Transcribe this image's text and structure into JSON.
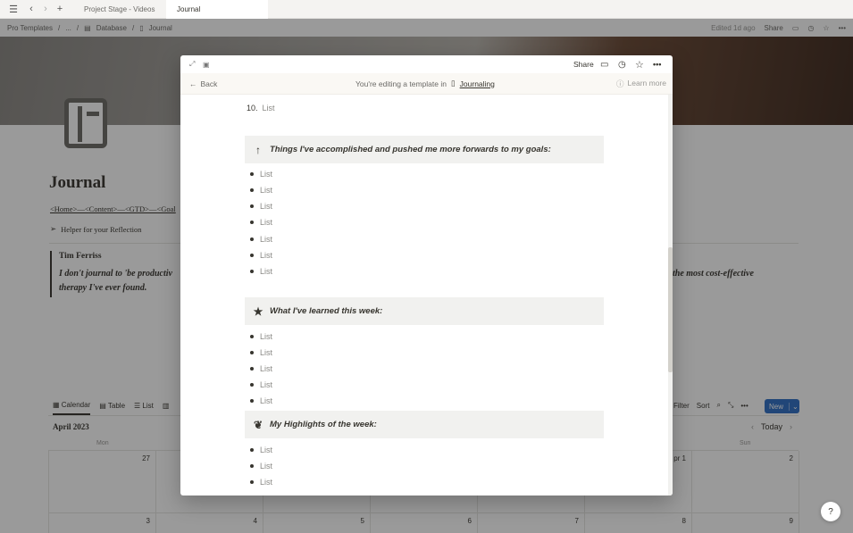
{
  "browser": {
    "tabs": [
      "Project Stage - Videos",
      "Journal"
    ]
  },
  "header": {
    "breadcrumbs": [
      "Pro Templates",
      "/",
      "...",
      "/",
      "Database",
      "/",
      "Journal"
    ],
    "edited": "Edited 1d ago",
    "share": "Share"
  },
  "page": {
    "title": "Journal",
    "nav_links": "<Home>—<Content>—<GTD>—<Goal",
    "helper": "Helper for your Reflection",
    "quote_author": "Tim Ferriss",
    "quote_line1": "I don't journal to 'be productiv",
    "quote_line1_right": "the most cost-effective",
    "quote_line2": "therapy I've ever found."
  },
  "database": {
    "views": [
      "Calendar",
      "Table",
      "List"
    ],
    "toolbar": [
      "Filter",
      "Sort"
    ],
    "new_label": "New",
    "month": "April 2023",
    "today": "Today",
    "weekdays": [
      "Mon",
      "Sun"
    ],
    "row1_days": [
      "27",
      "pr 1",
      "2"
    ],
    "row2_days": [
      "3",
      "4",
      "5",
      "6",
      "7",
      "8",
      "9"
    ]
  },
  "modal": {
    "share": "Share",
    "back": "Back",
    "editing_text": "You're editing a template in",
    "template_db": "Journaling",
    "learn_more": "Learn more",
    "numbered_item": {
      "number": "10.",
      "text": "List"
    },
    "sections": [
      {
        "icon": "rocket-icon",
        "glyph": "↑",
        "title": "Things I've accomplished and pushed me more forwards to my goals:",
        "items": [
          "List",
          "List",
          "List",
          "List",
          "List",
          "List",
          "List"
        ]
      },
      {
        "icon": "star-icon",
        "glyph": "★",
        "title": "What I've learned this week:",
        "items": [
          "List",
          "List",
          "List",
          "List",
          "List"
        ]
      },
      {
        "icon": "butterfly-icon",
        "glyph": "❦",
        "title": "My Highlights of the week:",
        "items": [
          "List",
          "List",
          "List"
        ]
      }
    ]
  },
  "help": "?"
}
